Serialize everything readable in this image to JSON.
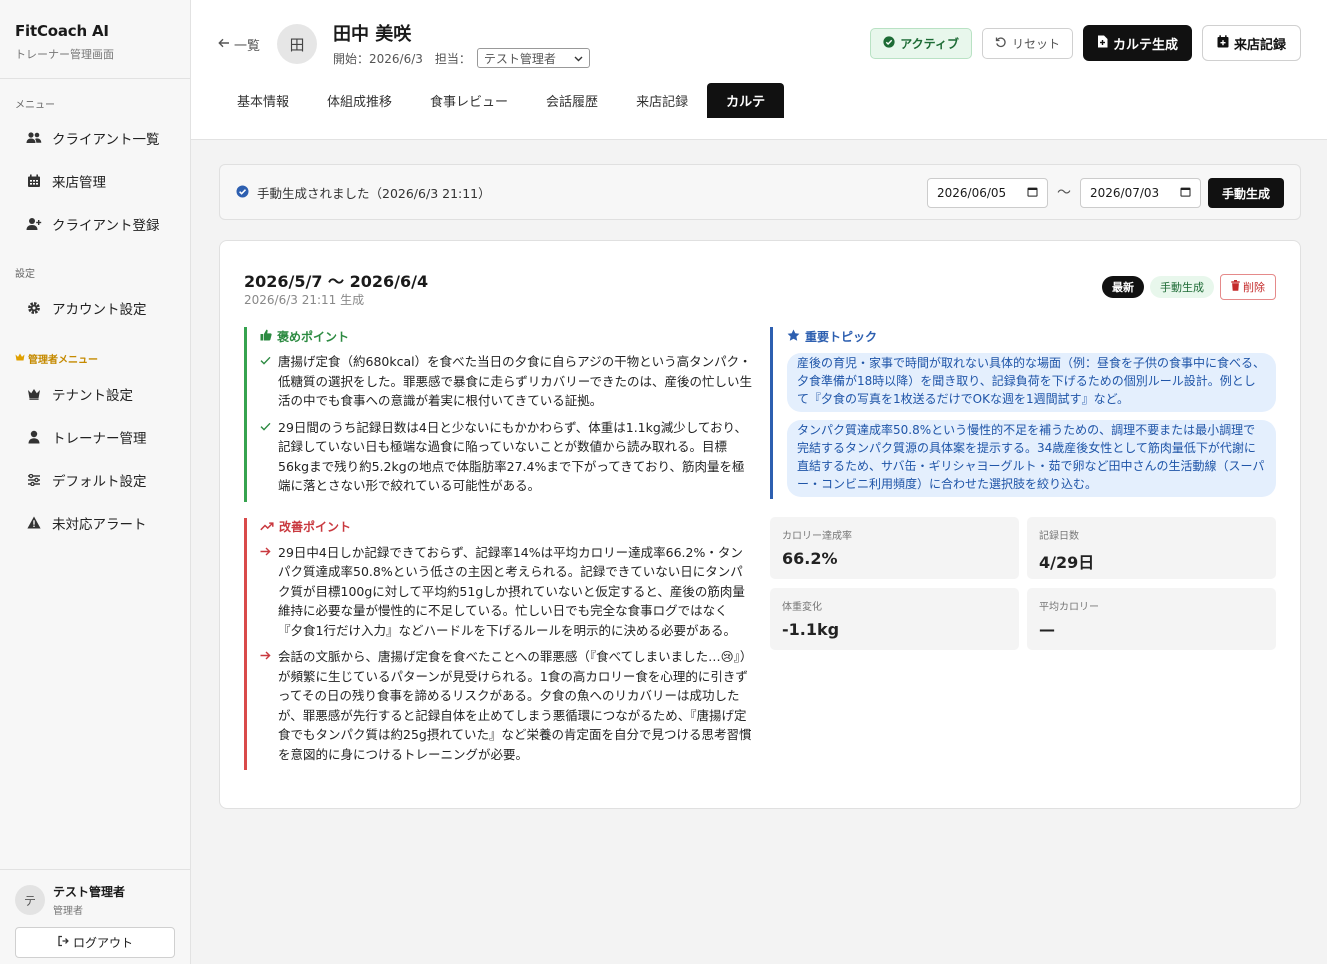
{
  "brand": {
    "title": "FitCoach AI",
    "subtitle": "トレーナー管理画面"
  },
  "sidebar": {
    "menu_label": "メニュー",
    "menu_items": [
      {
        "label": "クライアント一覧",
        "icon": "users-icon"
      },
      {
        "label": "来店管理",
        "icon": "calendar-icon"
      },
      {
        "label": "クライアント登録",
        "icon": "user-plus-icon"
      }
    ],
    "settings_label": "設定",
    "settings_items": [
      {
        "label": "アカウント設定",
        "icon": "gear-icon"
      }
    ],
    "admin_label": "管理者メニュー",
    "admin_items": [
      {
        "label": "テナント設定",
        "icon": "crown-icon"
      },
      {
        "label": "トレーナー管理",
        "icon": "user-icon"
      },
      {
        "label": "デフォルト設定",
        "icon": "sliders-icon"
      },
      {
        "label": "未対応アラート",
        "icon": "warning-icon"
      }
    ],
    "user": {
      "initial": "テ",
      "name": "テスト管理者",
      "role": "管理者"
    },
    "logout_label": "ログアウト"
  },
  "header": {
    "back_label": "一覧",
    "avatar_initial": "田",
    "client_name": "田中 美咲",
    "start_label": "開始：2026/6/3",
    "assignee_label": "担当：",
    "assignee_value": "テスト管理者",
    "status": "アクティブ",
    "reset_label": "リセット",
    "karte_gen_label": "カルテ生成",
    "visit_record_label": "来店記録",
    "tabs": [
      "基本情報",
      "体組成推移",
      "食事レビュー",
      "会話履歴",
      "来店記録",
      "カルテ"
    ],
    "active_tab": "カルテ"
  },
  "generation": {
    "status": "手動生成されました（2026/6/3 21:11）",
    "date_from": "2026/06/05",
    "separator": "〜",
    "date_to": "2026/07/03",
    "button": "手動生成"
  },
  "karte": {
    "period": "2026/5/7 〜 2026/6/4",
    "generated_at": "2026/6/3 21:11 生成",
    "tag_latest": "最新",
    "tag_manual": "手動生成",
    "delete_label": "削除",
    "good_title": "褒めポイント",
    "good_points": [
      "唐揚げ定食（約680kcal）を食べた当日の夕食に自らアジの干物という高タンパク・低糖質の選択をした。罪悪感で暴食に走らずリカバリーできたのは、産後の忙しい生活の中でも食事への意識が着実に根付いてきている証拠。",
      "29日間のうち記録日数は4日と少ないにもかかわらず、体重は1.1kg減少しており、記録していない日も極端な過食に陥っていないことが数値から読み取れる。目標56kgまで残り約5.2kgの地点で体脂肪率27.4%まで下がってきており、筋肉量を極端に落とさない形で絞れている可能性がある。"
    ],
    "improve_title": "改善ポイント",
    "improve_points": [
      "29日中4日しか記録できておらず、記録率14%は平均カロリー達成率66.2%・タンパク質達成率50.8%という低さの主因と考えられる。記録できていない日にタンパク質が目標100gに対して平均約51gしか摂れていないと仮定すると、産後の筋肉量維持に必要な量が慢性的に不足している。忙しい日でも完全な食事ログではなく『夕食1行だけ入力』などハードルを下げるルールを明示的に決める必要がある。",
      "会話の文脈から、唐揚げ定食を食べたことへの罪悪感（『食べてしまいました…😢』）が頻繁に生じているパターンが見受けられる。1食の高カロリー食を心理的に引きずってその日の残り食事を諦めるリスクがある。夕食の魚へのリカバリーは成功したが、罪悪感が先行すると記録自体を止めてしまう悪循環につながるため、『唐揚げ定食でもタンパク質は約25g摂れていた』など栄養の肯定面を自分で見つける思考習慣を意図的に身につけるトレーニングが必要。"
    ],
    "topics_title": "重要トピック",
    "topics": [
      "産後の育児・家事で時間が取れない具体的な場面（例：昼食を子供の食事中に食べる、夕食準備が18時以降）を聞き取り、記録負荷を下げるための個別ルール設計。例として『夕食の写真を1枚送るだけでOKな週を1週間試す』など。",
      "タンパク質達成率50.8%という慢性的不足を補うための、調理不要または最小調理で完結するタンパク質源の具体案を提示する。34歳産後女性として筋肉量低下が代謝に直結するため、サバ缶・ギリシャヨーグルト・茹で卵など田中さんの生活動線（スーパー・コンビニ利用頻度）に合わせた選択肢を絞り込む。"
    ],
    "stats": [
      {
        "label": "カロリー達成率",
        "value": "66.2%"
      },
      {
        "label": "記録日数",
        "value": "4/29日"
      },
      {
        "label": "体重変化",
        "value": "-1.1kg"
      },
      {
        "label": "平均カロリー",
        "value": "—"
      }
    ]
  }
}
